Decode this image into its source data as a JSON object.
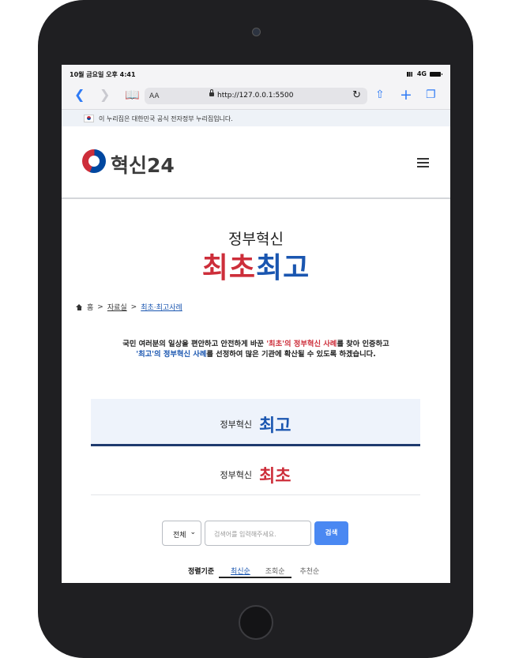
{
  "status_bar": {
    "time": "10월 금요일 오후 4:41",
    "network": "4G"
  },
  "browser": {
    "text_size_label": "AA",
    "url": "http://127.0.0.1:5500",
    "icons": [
      "back-chevron-icon",
      "forward-chevron-icon",
      "book-icon",
      "lock-icon",
      "reload-icon",
      "share-icon",
      "plus-icon",
      "tabs-icon"
    ]
  },
  "gov_notice": {
    "text": "이 누리집은 대한민국 공식 전자정부 누리집입니다."
  },
  "header": {
    "logo_text": "혁신24"
  },
  "hero": {
    "subtitle": "정부혁신",
    "title_part1": "최초",
    "title_part2": "최고"
  },
  "breadcrumb": {
    "home": "홈",
    "sep": ">",
    "level1": "자료실",
    "level2": "최초·최고사례"
  },
  "intro": {
    "line1_a": "국민 여러분의 일상을 편안하고 안전하게 바꾼 ",
    "line1_hl": "'최초'의 정부혁신 사례",
    "line1_b": "를 찾아 인증하고",
    "line2_hl": "'최고'의 정부혁신 사례",
    "line2_b": "를 선정하여 많은 기관에 확산될 수 있도록 하겠습니다."
  },
  "tabs": [
    {
      "small": "정부혁신",
      "big": "최고"
    },
    {
      "small": "정부혁신",
      "big": "최초"
    }
  ],
  "search": {
    "select_value": "전체",
    "placeholder": "검색어를 입력해주세요.",
    "button": "검색"
  },
  "sort": {
    "label": "정렬기준",
    "options": [
      "최신순",
      "조회순",
      "추천순"
    ],
    "active": "최신순"
  },
  "colors": {
    "accent_red": "#cd2e3a",
    "accent_blue": "#1a56b0",
    "search_button": "#4a88f2",
    "tab_active_border": "#1e3a6e"
  }
}
